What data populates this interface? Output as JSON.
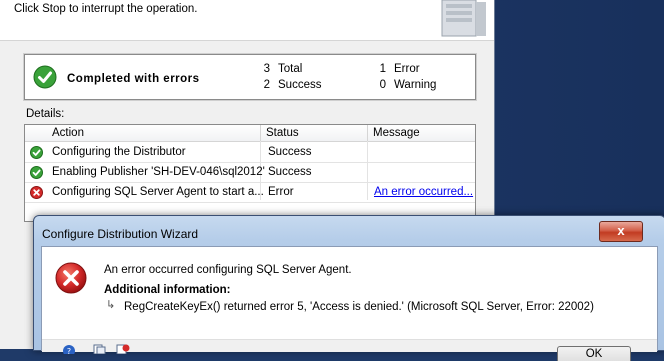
{
  "wizard": {
    "subtitle": "Click Stop to interrupt the operation.",
    "summary": {
      "status_text": "Completed with errors",
      "total_count": "3",
      "total_label": "Total",
      "success_count": "2",
      "success_label": "Success",
      "error_count": "1",
      "error_label": "Error",
      "warning_count": "0",
      "warning_label": "Warning"
    },
    "details_label": "Details:",
    "columns": [
      "Action",
      "Status",
      "Message"
    ],
    "rows": [
      {
        "icon": "success-icon",
        "action": "Configuring the Distributor",
        "status": "Success",
        "message": ""
      },
      {
        "icon": "success-icon",
        "action": "Enabling Publisher 'SH-DEV-046\\sql2012'",
        "status": "Success",
        "message": ""
      },
      {
        "icon": "error-icon",
        "action": "Configuring SQL Server Agent to start a...",
        "status": "Error",
        "message": "An error occurred..."
      }
    ]
  },
  "dialog": {
    "title": "Configure Distribution Wizard",
    "close_symbol": "x",
    "message": "An error occurred configuring SQL Server Agent.",
    "additional_label": "Additional information:",
    "additional_detail": "RegCreateKeyEx() returned error 5, 'Access is denied.' (Microsoft SQL Server, Error: 22002)",
    "ok_label": "OK"
  },
  "colors": {
    "success": "#3aa23a",
    "error": "#d42a2a",
    "link": "#0000ee"
  }
}
